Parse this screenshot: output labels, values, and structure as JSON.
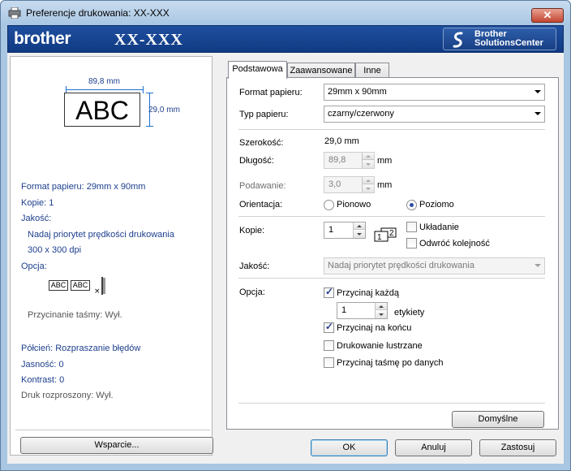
{
  "window": {
    "title": "Preferencje drukowania: XX-XXX",
    "close_label": "✕"
  },
  "brand": {
    "logo": "brother",
    "model": "XX-XXX",
    "solutions_line1": "Brother",
    "solutions_line2": "SolutionsCenter"
  },
  "preview": {
    "width_dim": "89,8 mm",
    "height_dim": "29,0 mm",
    "label_text": "ABC"
  },
  "summary": {
    "paper_format": "Format papieru: 29mm x 90mm",
    "copies": "Kopie: 1",
    "quality_heading": "Jakość:",
    "quality_value": "Nadaj priorytet prędkości drukowania",
    "resolution": "300 x 300 dpi",
    "option_heading": "Opcja:",
    "mini_label": "ABC",
    "tape_cut": "Przycinanie taśmy: Wył.",
    "halftone": "Półcień: Rozpraszanie błędów",
    "brightness": "Jasność:   0",
    "contrast": "Kontrast:   0",
    "distributed": "Druk rozproszony: Wył."
  },
  "support_button": "Wsparcie...",
  "tabs": [
    {
      "label": "Podstawowa",
      "active": true
    },
    {
      "label": "Zaawansowane",
      "active": false
    },
    {
      "label": "Inne",
      "active": false
    }
  ],
  "basic": {
    "paper_format_label": "Format papieru:",
    "paper_format_value": "29mm x 90mm",
    "paper_type_label": "Typ papieru:",
    "paper_type_value": "czarny/czerwony",
    "width_label": "Szerokość:",
    "width_value": "29,0 mm",
    "length_label": "Długość:",
    "length_value": "89,8",
    "length_unit": "mm",
    "feed_label": "Podawanie:",
    "feed_value": "3,0",
    "feed_unit": "mm",
    "orientation_label": "Orientacja:",
    "portrait_label": "Pionowo",
    "landscape_label": "Poziomo",
    "copies_label": "Kopie:",
    "copies_value": "1",
    "collate_label": "Układanie",
    "reverse_label": "Odwróć kolejność",
    "quality_label": "Jakość:",
    "quality_value": "Nadaj priorytet prędkości drukowania",
    "option_label": "Opcja:",
    "cut_each_label": "Przycinaj każdą",
    "cut_each_value": "1",
    "labels_word": "etykiety",
    "cut_end_label": "Przycinaj na końcu",
    "mirror_label": "Drukowanie lustrzane",
    "cut_data_label": "Przycinaj taśmę po danych",
    "defaults_button": "Domyślne",
    "collate_icon_n1": "1",
    "collate_icon_n2": "2"
  },
  "footer": {
    "ok": "OK",
    "cancel": "Anuluj",
    "apply": "Zastosuj"
  }
}
